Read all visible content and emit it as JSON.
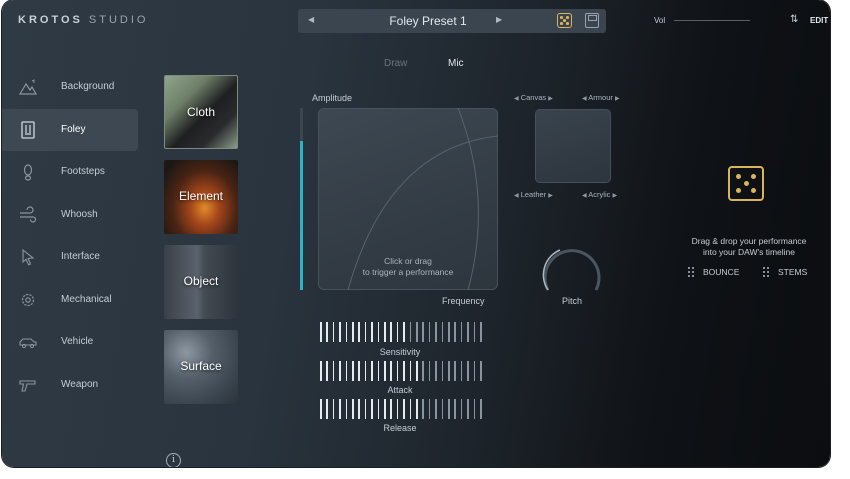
{
  "header": {
    "brand_bold": "KROTOS",
    "brand_light": "STUDIO",
    "preset_name": "Foley Preset 1",
    "vol_label": "Vol",
    "edit_label": "EDIT"
  },
  "sidebar": {
    "items": [
      {
        "label": "Background",
        "icon": "mountains-icon"
      },
      {
        "label": "Foley",
        "icon": "foley-box-icon"
      },
      {
        "label": "Footsteps",
        "icon": "footprint-icon"
      },
      {
        "label": "Whoosh",
        "icon": "whoosh-icon"
      },
      {
        "label": "Interface",
        "icon": "cursor-icon"
      },
      {
        "label": "Mechanical",
        "icon": "gear-icon"
      },
      {
        "label": "Vehicle",
        "icon": "car-icon"
      },
      {
        "label": "Weapon",
        "icon": "gun-icon"
      }
    ],
    "active": "Foley"
  },
  "categories": [
    "Cloth",
    "Element",
    "Object",
    "Surface"
  ],
  "modes": {
    "draw": "Draw",
    "mic": "Mic",
    "active": "Mic"
  },
  "pad": {
    "amplitude_label": "Amplitude",
    "frequency_label": "Frequency",
    "hint_line1": "Click or drag",
    "hint_line2": "to trigger a performance",
    "amplitude_level": 0.82
  },
  "blend": {
    "top_left": "Canvas",
    "top_right": "Armour",
    "bottom_left": "Leather",
    "bottom_right": "Acrylic"
  },
  "pitch": {
    "label": "Pitch"
  },
  "sliders": [
    {
      "label": "Sensitivity",
      "value": 0.55
    },
    {
      "label": "Attack",
      "value": 0.6
    },
    {
      "label": "Release",
      "value": 0.6
    }
  ],
  "export": {
    "line1": "Drag & drop your performance",
    "line2": "into your DAW's timeline",
    "bounce": "BOUNCE",
    "stems": "STEMS"
  },
  "colors": {
    "accent_teal": "#2bb4c8",
    "dice_gold": "#d9b55a"
  }
}
